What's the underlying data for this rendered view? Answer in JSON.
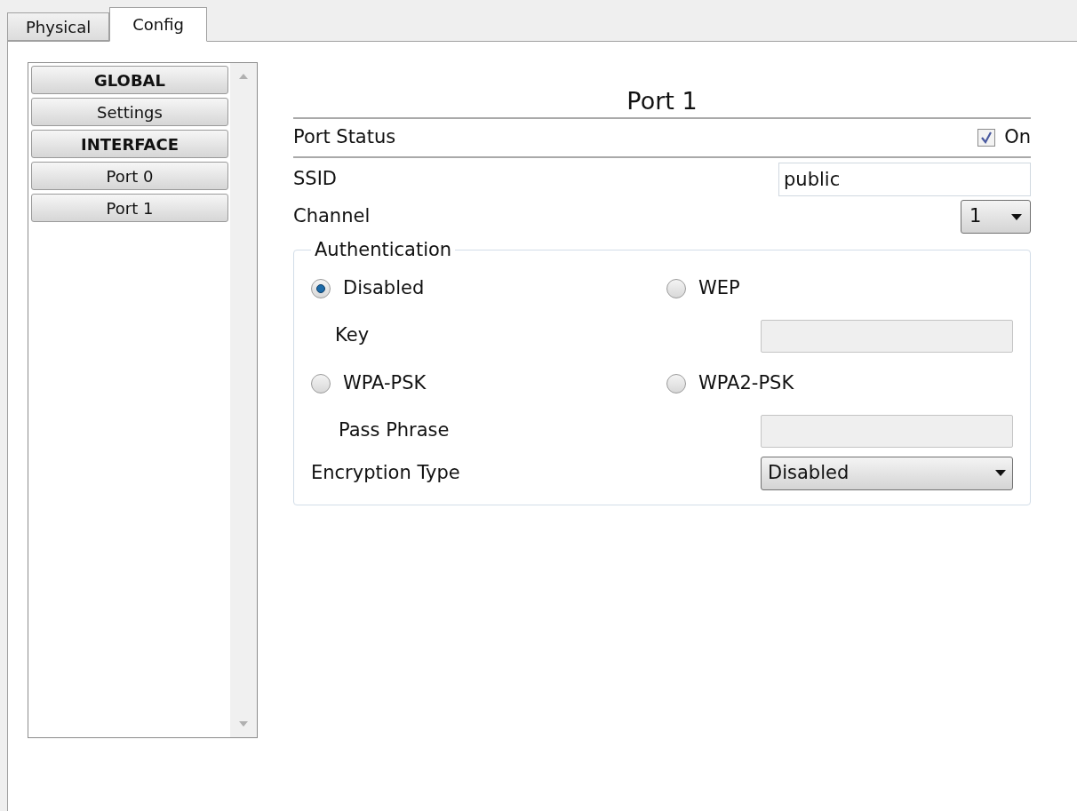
{
  "tabs": [
    {
      "label": "Physical",
      "selected": false
    },
    {
      "label": "Config",
      "selected": true
    }
  ],
  "sidebar": {
    "items": [
      {
        "label": "GLOBAL",
        "kind": "header"
      },
      {
        "label": "Settings",
        "kind": "item"
      },
      {
        "label": "INTERFACE",
        "kind": "header"
      },
      {
        "label": "Port 0",
        "kind": "item"
      },
      {
        "label": "Port 1",
        "kind": "item"
      }
    ]
  },
  "port": {
    "title": "Port 1",
    "port_status": {
      "label": "Port Status",
      "checkbox_label": "On",
      "checked": true
    },
    "ssid": {
      "label": "SSID",
      "value": "public"
    },
    "channel": {
      "label": "Channel",
      "value": "1"
    },
    "authentication": {
      "legend": "Authentication",
      "options": [
        {
          "label": "Disabled",
          "selected": true
        },
        {
          "label": "WEP",
          "selected": false
        },
        {
          "label": "WPA-PSK",
          "selected": false
        },
        {
          "label": "WPA2-PSK",
          "selected": false
        }
      ],
      "key": {
        "label": "Key"
      },
      "pass_phrase": {
        "label": "Pass Phrase"
      },
      "encryption": {
        "label": "Encryption Type",
        "value": "Disabled"
      }
    }
  }
}
